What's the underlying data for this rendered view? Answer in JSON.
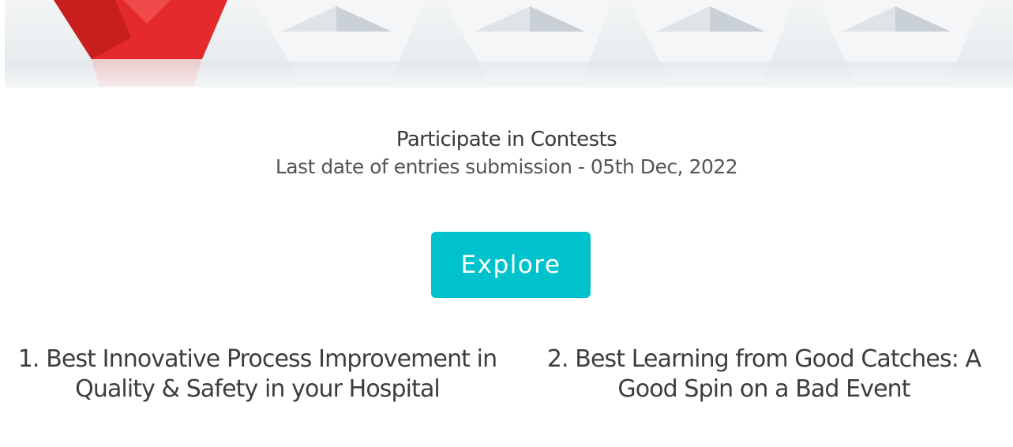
{
  "banner": {
    "image_alt": "Paper boats",
    "colors": {
      "red_boat": "#e42a2a",
      "white_boat": "#f1f3f5",
      "background": "#eceff1"
    }
  },
  "section": {
    "title": "Participate in Contests",
    "subtitle": "Last date of entries submission - 05th Dec, 2022"
  },
  "explore_button": {
    "label": "Explore",
    "color": "#00c2cc"
  },
  "contests": [
    {
      "title": "1. Best Innovative Process Improvement in Quality & Safety in your Hospital"
    },
    {
      "title": "2. Best Learning from Good Catches: A Good Spin on a Bad Event"
    }
  ]
}
